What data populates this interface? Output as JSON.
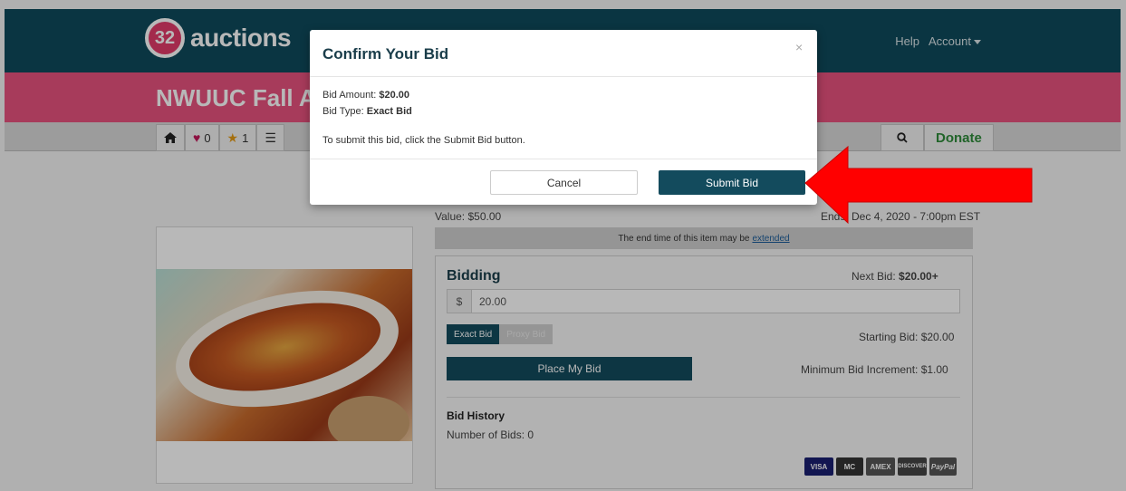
{
  "header": {
    "logo_number": "32",
    "logo_text": "auctions",
    "help": "Help",
    "account": "Account"
  },
  "auction": {
    "title": "NWUUC Fall Auction"
  },
  "nav": {
    "favorites_count": "0",
    "watch_count": "1",
    "donate": "Donate"
  },
  "item": {
    "value": "Value: $50.00",
    "ends": "Ends: Dec 4, 2020 - 7:00pm EST",
    "notice": "The end time of this item may be",
    "notice_link": "extended"
  },
  "bidding": {
    "title": "Bidding",
    "next_bid_label": "Next Bid:",
    "next_bid_value": "$20.00+",
    "currency": "$",
    "amount": "20.00",
    "exact_bid": "Exact Bid",
    "proxy_bid": "Proxy Bid",
    "starting_bid": "Starting Bid: $20.00",
    "place_bid": "Place My Bid",
    "min_increment": "Minimum Bid Increment: $1.00",
    "history_title": "Bid History",
    "bid_count": "Number of Bids: 0",
    "cards": [
      "VISA",
      "MC",
      "AMEX",
      "DISCOVER",
      "PayPal"
    ]
  },
  "modal": {
    "title": "Confirm Your Bid",
    "close": "×",
    "amount_label": "Bid Amount:",
    "amount_value": "$20.00",
    "type_label": "Bid Type:",
    "type_value": "Exact Bid",
    "instruction": "To submit this bid, click the Submit Bid button.",
    "cancel": "Cancel",
    "submit": "Submit Bid"
  },
  "colors": {
    "brand_teal": "#134b5d",
    "brand_pink": "#e8527e",
    "annotation_arrow": "#ff0000"
  }
}
